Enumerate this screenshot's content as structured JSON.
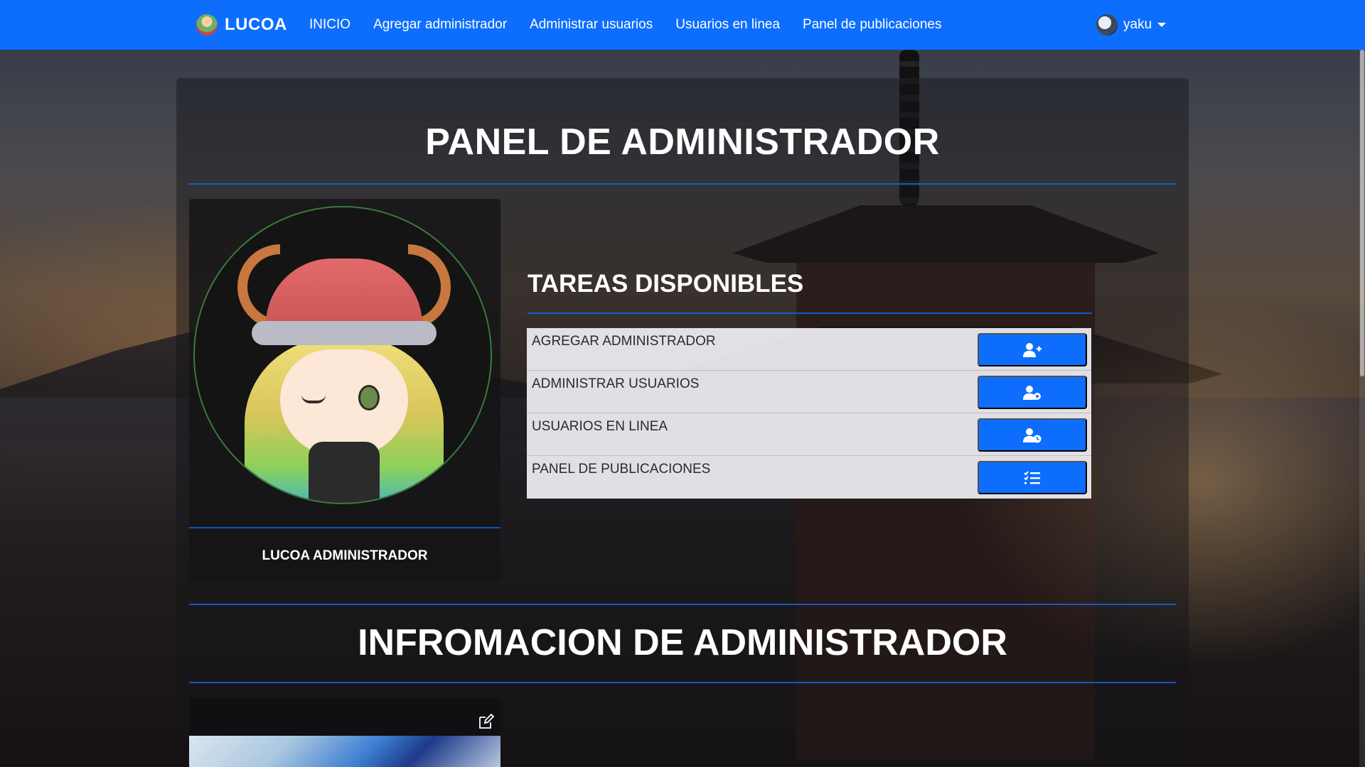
{
  "navbar": {
    "brand": "LUCOA",
    "links": [
      "INICIO",
      "Agregar administrador",
      "Administrar usuarios",
      "Usuarios en linea",
      "Panel de publicaciones"
    ],
    "user": "yaku"
  },
  "panel": {
    "title": "PANEL DE ADMINISTRADOR"
  },
  "profile": {
    "name": "LUCOA ADMINISTRADOR"
  },
  "tasks": {
    "title": "TAREAS DISPONIBLES",
    "items": [
      {
        "label": "AGREGAR ADMINISTRADOR",
        "icon": "user-plus-icon"
      },
      {
        "label": "ADMINISTRAR USUARIOS",
        "icon": "user-gear-icon"
      },
      {
        "label": "USUARIOS EN LINEA",
        "icon": "user-clock-icon"
      },
      {
        "label": "PANEL DE PUBLICACIONES",
        "icon": "list-check-icon"
      }
    ]
  },
  "info": {
    "title": "INFROMACION DE ADMINISTRADOR"
  },
  "colors": {
    "primary": "#0d6efd",
    "text_light": "#ffffff"
  }
}
